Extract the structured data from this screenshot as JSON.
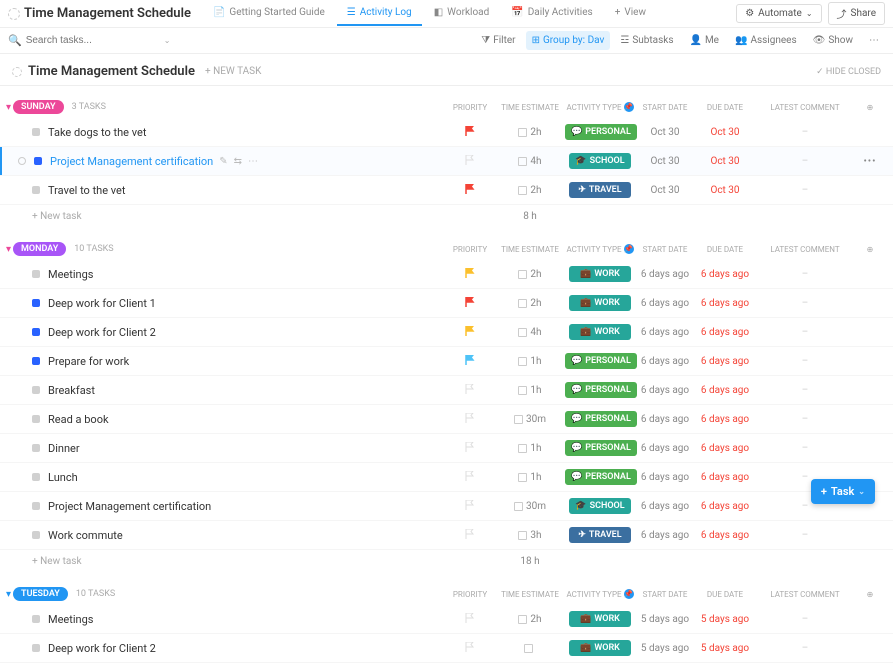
{
  "header": {
    "title": "Time Management Schedule",
    "tabs": [
      {
        "label": "Getting Started Guide"
      },
      {
        "label": "Activity Log"
      },
      {
        "label": "Workload"
      },
      {
        "label": "Daily Activities"
      }
    ],
    "view": "View",
    "automate": "Automate",
    "share": "Share"
  },
  "toolbar": {
    "search_placeholder": "Search tasks...",
    "filter": "Filter",
    "group_by": "Group by: Dav",
    "subtasks": "Subtasks",
    "me": "Me",
    "assignees": "Assignees",
    "show": "Show"
  },
  "list": {
    "title": "Time Management Schedule",
    "new_task": "+ NEW TASK",
    "hide_closed": "HIDE CLOSED"
  },
  "columns": {
    "priority": "PRIORITY",
    "time": "TIME ESTIMATE",
    "type": "ACTIVITY TYPE",
    "start": "START DATE",
    "due": "DUE DATE",
    "comment": "LATEST COMMENT",
    "add": "⊕"
  },
  "type_colors": {
    "PERSONAL": "#4caf50",
    "SCHOOL": "#26a69a",
    "TRAVEL": "#3b6fa0",
    "WORK": "#26a69a"
  },
  "type_icons": {
    "PERSONAL": "💬",
    "SCHOOL": "🎓",
    "TRAVEL": "✈",
    "WORK": "💼"
  },
  "groups": [
    {
      "name": "SUNDAY",
      "pill_class": "pill-pink",
      "collapse_class": "",
      "count": "3 TASKS",
      "total": "8 h",
      "tasks": [
        {
          "name": "Take dogs to the vet",
          "status": "#d0d0d0",
          "priority": "#f44336",
          "time": "2h",
          "type": "PERSONAL",
          "start": "Oct 30",
          "due": "Oct 30",
          "due_class": "due-red",
          "comment": "–"
        },
        {
          "name": "Project Management certification",
          "status": "#2962ff",
          "priority": "",
          "time": "4h",
          "type": "SCHOOL",
          "start": "Oct 30",
          "due": "Oct 30",
          "due_class": "due-red",
          "comment": "–",
          "selected": true,
          "more": true
        },
        {
          "name": "Travel to the vet",
          "status": "#d0d0d0",
          "priority": "#f44336",
          "time": "2h",
          "type": "TRAVEL",
          "start": "Oct 30",
          "due": "Oct 30",
          "due_class": "due-red",
          "comment": "–"
        }
      ]
    },
    {
      "name": "MONDAY",
      "pill_class": "pill-violet",
      "collapse_class": "",
      "count": "10 TASKS",
      "total": "18 h",
      "tasks": [
        {
          "name": "Meetings",
          "status": "#d0d0d0",
          "priority": "#fbc02d",
          "time": "2h",
          "type": "WORK",
          "start": "6 days ago",
          "due": "6 days ago",
          "due_class": "due-red",
          "comment": "–"
        },
        {
          "name": "Deep work for Client 1",
          "status": "#2962ff",
          "priority": "#f44336",
          "time": "2h",
          "type": "WORK",
          "start": "6 days ago",
          "due": "6 days ago",
          "due_class": "due-red",
          "comment": "–"
        },
        {
          "name": "Deep work for Client 2",
          "status": "#2962ff",
          "priority": "#fbc02d",
          "time": "4h",
          "type": "WORK",
          "start": "6 days ago",
          "due": "6 days ago",
          "due_class": "due-red",
          "comment": "–"
        },
        {
          "name": "Prepare for work",
          "status": "#2962ff",
          "priority": "#4fc3f7",
          "time": "1h",
          "type": "PERSONAL",
          "start": "6 days ago",
          "due": "6 days ago",
          "due_class": "due-red",
          "comment": "–"
        },
        {
          "name": "Breakfast",
          "status": "#d0d0d0",
          "priority": "",
          "time": "1h",
          "type": "PERSONAL",
          "start": "6 days ago",
          "due": "6 days ago",
          "due_class": "due-red",
          "comment": "–"
        },
        {
          "name": "Read a book",
          "status": "#d0d0d0",
          "priority": "",
          "time": "30m",
          "type": "PERSONAL",
          "start": "6 days ago",
          "due": "6 days ago",
          "due_class": "due-red",
          "comment": "–"
        },
        {
          "name": "Dinner",
          "status": "#d0d0d0",
          "priority": "",
          "time": "1h",
          "type": "PERSONAL",
          "start": "6 days ago",
          "due": "6 days ago",
          "due_class": "due-red",
          "comment": "–"
        },
        {
          "name": "Lunch",
          "status": "#d0d0d0",
          "priority": "",
          "time": "1h",
          "type": "PERSONAL",
          "start": "6 days ago",
          "due": "6 days ago",
          "due_class": "due-red",
          "comment": "–"
        },
        {
          "name": "Project Management certification",
          "status": "#d0d0d0",
          "priority": "",
          "time": "30m",
          "type": "SCHOOL",
          "start": "6 days ago",
          "due": "6 days ago",
          "due_class": "due-red",
          "comment": "–"
        },
        {
          "name": "Work commute",
          "status": "#d0d0d0",
          "priority": "",
          "time": "3h",
          "type": "TRAVEL",
          "start": "6 days ago",
          "due": "6 days ago",
          "due_class": "due-red",
          "comment": "–"
        }
      ]
    },
    {
      "name": "TUESDAY",
      "pill_class": "pill-blue",
      "collapse_class": "blue",
      "count": "10 TASKS",
      "total": "",
      "tasks": [
        {
          "name": "Meetings",
          "status": "#d0d0d0",
          "priority": "",
          "time": "2h",
          "type": "WORK",
          "start": "5 days ago",
          "due": "5 days ago",
          "due_class": "due-red",
          "comment": "–"
        },
        {
          "name": "Deep work for Client 2",
          "status": "#d0d0d0",
          "priority": "",
          "time": "",
          "type": "WORK",
          "start": "5 days ago",
          "due": "5 days ago",
          "due_class": "due-red",
          "comment": "–"
        }
      ]
    }
  ],
  "new_task_label": "+ New task",
  "fab": "Task"
}
